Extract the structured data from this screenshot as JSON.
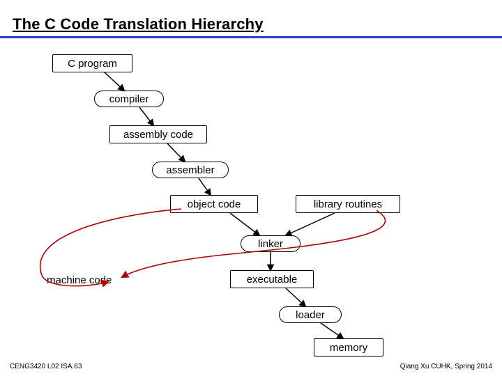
{
  "title": "The C Code Translation Hierarchy",
  "nodes": {
    "c_program": "C program",
    "compiler": "compiler",
    "assembly_code": "assembly code",
    "assembler": "assembler",
    "object_code": "object code",
    "library_routines": "library routines",
    "linker": "linker",
    "machine_code": "machine code",
    "executable": "executable",
    "loader": "loader",
    "memory": "memory"
  },
  "edges": [
    {
      "from": "c_program",
      "to": "compiler"
    },
    {
      "from": "compiler",
      "to": "assembly_code"
    },
    {
      "from": "assembly_code",
      "to": "assembler"
    },
    {
      "from": "assembler",
      "to": "object_code"
    },
    {
      "from": "object_code",
      "to": "linker"
    },
    {
      "from": "library_routines",
      "to": "linker"
    },
    {
      "from": "linker",
      "to": "executable"
    },
    {
      "from": "executable",
      "to": "loader"
    },
    {
      "from": "loader",
      "to": "memory"
    },
    {
      "from": "object_code",
      "to": "machine_code",
      "style": "curved_red"
    },
    {
      "from": "library_routines",
      "to": "machine_code",
      "style": "curved_red"
    }
  ],
  "footer": {
    "left": "CENG3420 L02 ISA.63",
    "right": "Qiang Xu   CUHK, Spring 2014"
  }
}
